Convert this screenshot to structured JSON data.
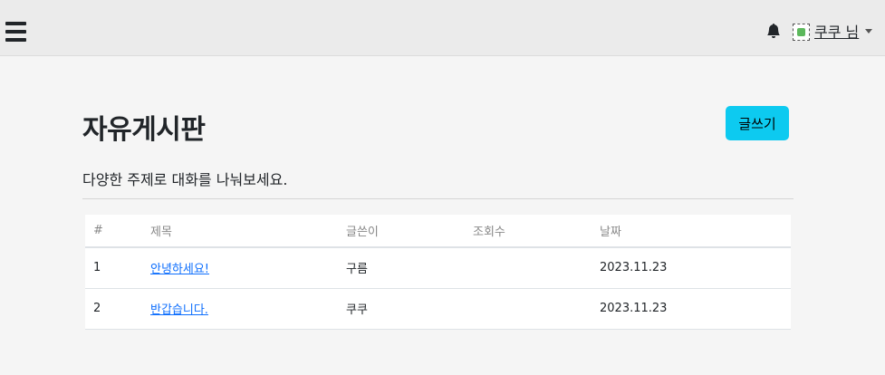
{
  "header": {
    "user_name": "쿠쿠 님",
    "icons": [
      "menu-icon",
      "bell-icon",
      "avatar-image",
      "caret-down-icon"
    ]
  },
  "main": {
    "title": "자유게시판",
    "write_button": "글쓰기",
    "subtitle": "다양한 주제로 대화를 나눠보세요."
  },
  "table": {
    "headers": [
      "#",
      "제목",
      "글쓴이",
      "조회수",
      "날짜"
    ],
    "rows": [
      {
        "num": "1",
        "title": "안녕하세요!",
        "writer": "구름",
        "views": "",
        "date": "2023.11.23"
      },
      {
        "num": "2",
        "title": "반갑습니다.",
        "writer": "쿠쿠",
        "views": "",
        "date": "2023.11.23"
      }
    ]
  },
  "colors": {
    "accent": "#0dcaf0",
    "link": "#0d6efd",
    "header_bg": "#ebebeb",
    "page_bg": "#f5f5f5"
  }
}
